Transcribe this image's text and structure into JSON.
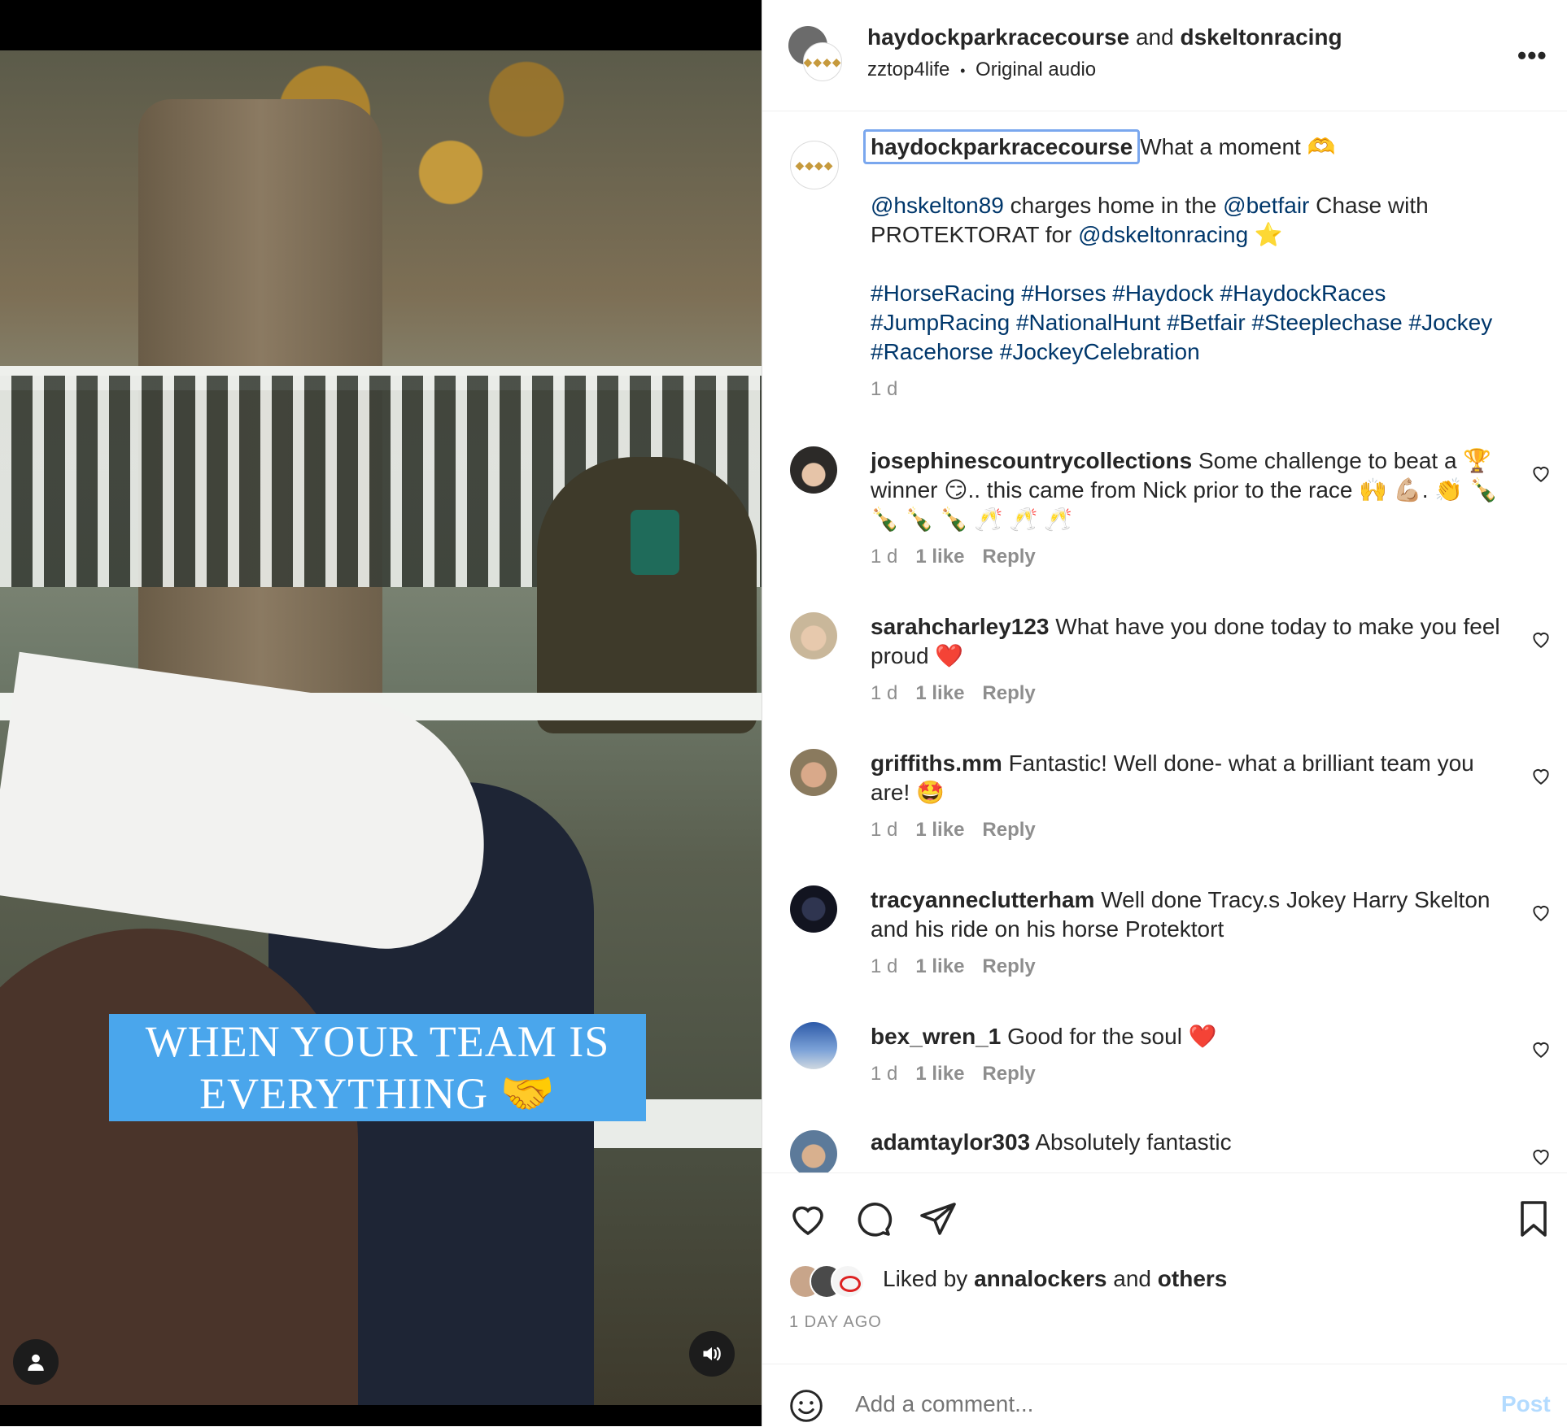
{
  "video": {
    "overlay_text": "WHEN YOUR TEAM IS EVERYTHING 🤝",
    "user_icon": "user-icon",
    "sound_icon": "sound-icon"
  },
  "header": {
    "account1": "haydockparkracecourse",
    "and_word": "and",
    "account2": "dskeltonracing",
    "audio_user": "zztop4life",
    "separator": "•",
    "audio_label": "Original audio",
    "more_label": "•••"
  },
  "caption": {
    "author": "haydockparkracecourse",
    "line1": "What a moment 🫶",
    "mention1": "@hskelton89",
    "text2": " charges home in the ",
    "mention2": "@betfair",
    "text3": " Chase with PROTEKTORAT for ",
    "mention3": "@dskeltonracing",
    "text4": " ⭐",
    "hashtags1": "#HorseRacing #Horses #Haydock #HaydockRaces",
    "hashtags2": "#JumpRacing #NationalHunt #Betfair #Steeplechase #Jockey",
    "hashtags3": "#Racehorse #JockeyCelebration",
    "time": "1 d"
  },
  "comments": [
    {
      "user": "josephinescountrycollections",
      "text": "Some challenge to beat a 🏆 winner 😏.. this came from Nick prior to the race 🙌 💪🏼. 👏 🍾 🍾 🍾 🍾 🥂 🥂 🥂",
      "time": "1 d",
      "likes": "1 like",
      "reply": "Reply"
    },
    {
      "user": "sarahcharley123",
      "text": "What have you done today to make you feel proud ❤️",
      "time": "1 d",
      "likes": "1 like",
      "reply": "Reply"
    },
    {
      "user": "griffiths.mm",
      "text": "Fantastic! Well done- what a brilliant team you are! 🤩",
      "time": "1 d",
      "likes": "1 like",
      "reply": "Reply"
    },
    {
      "user": "tracyanneclutterham",
      "text": "Well done Tracy.s Jokey Harry Skelton and his ride on his horse Protektort",
      "time": "1 d",
      "likes": "1 like",
      "reply": "Reply"
    },
    {
      "user": "bex_wren_1",
      "text": "Good for the soul ❤️",
      "time": "1 d",
      "likes": "1 like",
      "reply": "Reply"
    },
    {
      "user": "adamtaylor303",
      "text": "Absolutely fantastic"
    }
  ],
  "actions": {
    "like_icon": "heart-icon",
    "comment_icon": "comment-icon",
    "share_icon": "paper-plane-icon",
    "save_icon": "bookmark-icon",
    "liked_prefix": "Liked by ",
    "liked_user": "annalockers",
    "liked_and": " and ",
    "liked_others": "others",
    "date": "1 DAY AGO"
  },
  "add_comment": {
    "emoji_icon": "smiley-icon",
    "placeholder": "Add a comment...",
    "post_label": "Post"
  },
  "colors": {
    "link": "#00376b",
    "muted": "#8e8e8e",
    "post_button": "#b3dbff",
    "overlay_bg": "#4aa6ec",
    "focus_ring": "#7aa7ee"
  }
}
